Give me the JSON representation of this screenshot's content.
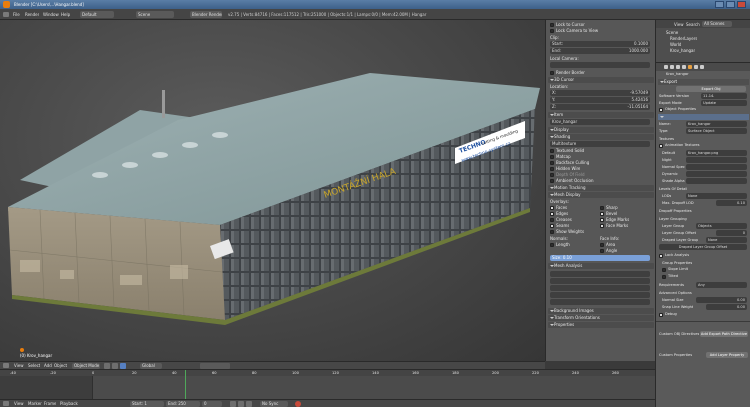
{
  "title_bar": {
    "app": "Blender",
    "title": "[C:\\Users\\...\\Hangar.blend]"
  },
  "menu": {
    "items": [
      "File",
      "Render",
      "Window",
      "Help"
    ],
    "layout": "Default",
    "scene": "Scene",
    "engine": "Blender Render",
    "stats": "v2.75 | Verts:84716 | Faces:117512 | Tris:251000 | Objects:1/1 | Lamps:0/0 | Mem:42.00M | Hangar"
  },
  "viewport": {
    "label": "(0) Krov_hangar",
    "sign_text": "MONTÁŽNÍ HALA",
    "banner_line1": "TECHNO",
    "banner_line2": "cutting & moulding",
    "banner_line3": "www.techno-system.cz"
  },
  "view_header": {
    "items": [
      "View",
      "Select",
      "Add",
      "Object"
    ],
    "mode": "Object Mode",
    "pivot": "Global"
  },
  "npanel": {
    "lock_cursor": "Lock to Cursor",
    "lock_camera": "Lock Camera to View",
    "clip": "Clip:",
    "start_label": "Start:",
    "start_value": "0.1000",
    "end_label": "End:",
    "end_value": "1000.000",
    "local_camera": "Local Camera:",
    "render_border": "Render Border",
    "cursor_section": "3D Cursor",
    "location": "Location:",
    "x_label": "X:",
    "x_value": "-9.57049",
    "y_label": "Y:",
    "y_value": "5.42416",
    "z_label": "Z:",
    "z_value": "-11.05164",
    "item_section": "Item",
    "item_name": "Krov_hangar",
    "display_section": "Display",
    "shading_section": "Shading",
    "shading_mode": "Multitexture",
    "textured_solid": "Textured Solid",
    "matcap": "Matcap",
    "backface_culling": "Backface Culling",
    "hidden_wire": "Hidden Wire",
    "depth_of_field": "Depth Of Field",
    "ambient_occlusion": "Ambient Occlusion",
    "motion_tracking": "Motion Tracking",
    "mesh_display": "Mesh Display",
    "overlays": "Overlays:",
    "faces": "Faces",
    "edges": "Edges",
    "creases": "Creases",
    "seams": "Seams",
    "sharp": "Sharp",
    "bevel": "Bevel",
    "edge_marks": "Edge Marks",
    "face_marks": "Face Marks",
    "show_weights": "Show Weights",
    "normals": "Normals:",
    "face_info": "Face Info:",
    "length": "Length",
    "area": "Area",
    "angle": "Angle",
    "size_label": "Size: 0.10",
    "mesh_analysis": "Mesh Analysis",
    "background_images": "Background Images",
    "transform_orientations": "Transform Orientations",
    "properties": "Properties"
  },
  "outliner": {
    "view": "View",
    "search": "Search",
    "filter": "All Scenes",
    "rows": [
      "Scene",
      "RenderLayers",
      "World",
      "Krov_hangar"
    ]
  },
  "props": {
    "context_label": "Krov_hangar",
    "export_section": "Export",
    "export_btn": "Export Obj",
    "map_version": "Software Version",
    "map_version_value": "11.14.",
    "export_mode_label": "Export Mode",
    "export_mode_value": "Update",
    "object_properties": "Object Properties",
    "objectname_label": "Name:",
    "objectname_value": "Krov_hangar",
    "type_label": "Type:",
    "type_value": "Surface Object",
    "texture_section": "Textures",
    "animation_textures": "Animation Textures",
    "default_label": "Default",
    "default_value": "Krov_hangar.png",
    "night_label": "Night",
    "normal_label": "Normal Spec",
    "dynamic_label": "Dynamic",
    "shade_label": "Shade Alpha",
    "lod_label": "Levels Of Detail",
    "lod_count_label": "LODs",
    "lod_count_value": "None",
    "max_lod_label": "Max. Dropoff LOD",
    "max_lod_value": "0.10",
    "dropoff_label": "Dropoff Properties",
    "layer_group": "Layer Grouping",
    "layer_group_label": "Layer Group",
    "layer_group_value": "Objects",
    "layer_offset_label": "Layer Group Offset",
    "layer_offset_value": "0",
    "draped_label": "Draped Layer Group",
    "draped_value": "None",
    "draped_offset_label": "Draped Layer Group Offset",
    "lock_analysis": "Lock Analysis",
    "group_properties": "Group Properties",
    "slope_limit": "Slope Limit",
    "tilted": "Tilted",
    "requirements_label": "Requirements",
    "requirements_value": "Any",
    "advanced_section": "Advanced Options",
    "normal_size_label": "Normal Size",
    "normal_size_value": "0.00",
    "snap_label": "Snap Line Weight",
    "snap_value": "0.00",
    "debug": "Debug",
    "custom_header": "Custom OBJ Directives",
    "add_header_btn": "Add Export Path Directive",
    "custom_props": "Custom Properties",
    "add_custom_btn": "Add Layer Property"
  },
  "timeline": {
    "frame_start": "Start: 1",
    "frame_end": "End: 250",
    "frame_current": "0",
    "items": [
      "View",
      "Marker",
      "Frame",
      "Playback"
    ],
    "ticks": [
      "-40",
      "-20",
      "0",
      "20",
      "40",
      "60",
      "80",
      "100",
      "120",
      "140",
      "160",
      "180",
      "200",
      "220",
      "240",
      "260"
    ],
    "sync": "No Sync"
  },
  "colors": {
    "accent": "#5680c2",
    "selected": "#e87d0d",
    "panel": "#575757"
  }
}
